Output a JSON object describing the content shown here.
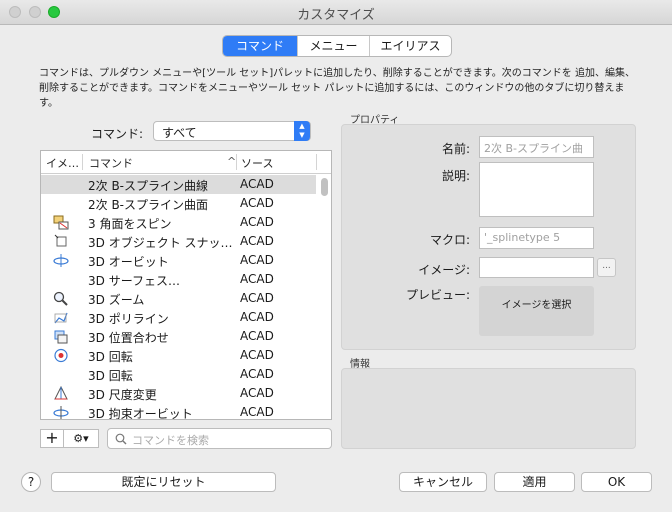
{
  "window": {
    "title": "カスタマイズ"
  },
  "tabs": [
    {
      "label": "コマンド",
      "active": true
    },
    {
      "label": "メニュー",
      "active": false
    },
    {
      "label": "エイリアス",
      "active": false
    }
  ],
  "description": "コマンドは、プルダウン メニューや[ツール セット]パレットに追加したり、削除することができます。次のコマンドを 追加、編集、削除することができます。コマンドをメニューやツール セット パレットに追加するには、このウィンドウの他のタブに切り替えます。",
  "filter": {
    "label": "コマンド:",
    "value": "すべて"
  },
  "table": {
    "headers": {
      "image": "イメ…",
      "command": "コマンド",
      "source": "ソース",
      "sort_indicator": "^"
    },
    "rows": [
      {
        "name": "2次 B-スプライン曲線",
        "source": "ACAD",
        "icon": "none",
        "selected": true
      },
      {
        "name": "2次 B-スプライン曲面",
        "source": "ACAD",
        "icon": "none",
        "selected": false
      },
      {
        "name": "3 角面をスピン",
        "source": "ACAD",
        "icon": "3dface-spin-icon",
        "selected": false
      },
      {
        "name": "3D オブジェクト スナッ…",
        "source": "ACAD",
        "icon": "3d-osnap-icon",
        "selected": false
      },
      {
        "name": "3D オービット",
        "source": "ACAD",
        "icon": "3d-orbit-icon",
        "selected": false
      },
      {
        "name": "3D サーフェス…",
        "source": "ACAD",
        "icon": "none",
        "selected": false
      },
      {
        "name": "3D ズーム",
        "source": "ACAD",
        "icon": "magnifier-icon",
        "selected": false
      },
      {
        "name": "3D ポリライン",
        "source": "ACAD",
        "icon": "3d-polyline-icon",
        "selected": false
      },
      {
        "name": "3D 位置合わせ",
        "source": "ACAD",
        "icon": "3d-align-icon",
        "selected": false
      },
      {
        "name": "3D 回転",
        "source": "ACAD",
        "icon": "3d-rotate-icon",
        "selected": false
      },
      {
        "name": "3D 回転",
        "source": "ACAD",
        "icon": "none",
        "selected": false
      },
      {
        "name": "3D 尺度変更",
        "source": "ACAD",
        "icon": "3d-scale-icon",
        "selected": false
      },
      {
        "name": "3D 拘束オービット",
        "source": "ACAD",
        "icon": "3d-constrained-orbit-icon",
        "selected": false
      }
    ]
  },
  "toolbar": {
    "add_label": "+",
    "gear_label": "⚙▾"
  },
  "search": {
    "placeholder": "コマンドを検索"
  },
  "properties": {
    "group_label": "プロパティ",
    "name_label": "名前:",
    "name_value": "2次 B-スプライン曲",
    "desc_label": "説明:",
    "macro_label": "マクロ:",
    "macro_value": "'_splinetype 5",
    "image_label": "イメージ:",
    "browse_label": "...",
    "preview_label": "プレビュー:",
    "select_image_label": "イメージを選択"
  },
  "info": {
    "group_label": "情報"
  },
  "footer": {
    "help_label": "?",
    "reset_label": "既定にリセット",
    "cancel_label": "キャンセル",
    "apply_label": "適用",
    "ok_label": "OK"
  }
}
